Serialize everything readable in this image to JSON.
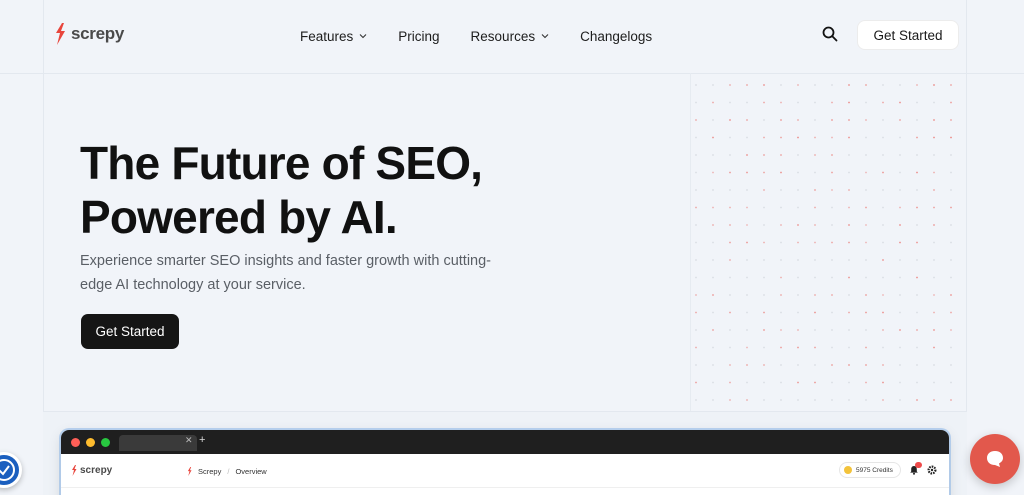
{
  "brand": {
    "name": "screpy",
    "accent": "#e8453c"
  },
  "nav": {
    "links": [
      {
        "label": "Features",
        "has_dropdown": true
      },
      {
        "label": "Pricing",
        "has_dropdown": false
      },
      {
        "label": "Resources",
        "has_dropdown": true
      },
      {
        "label": "Changelogs",
        "has_dropdown": false
      }
    ],
    "cta_label": "Get Started"
  },
  "hero": {
    "title_line1": "The Future of SEO,",
    "title_line2": "Powered by AI.",
    "subtitle": "Experience smarter SEO insights and faster growth with cutting-edge AI technology at your service.",
    "cta_label": "Get Started"
  },
  "preview": {
    "app_logo": "screpy",
    "breadcrumb": [
      "Screpy",
      "Overview"
    ],
    "credits": "5975 Credits"
  },
  "colors": {
    "dark_button": "#151515",
    "chat_button": "#e2584c",
    "a11y_button": "#1b5fbf"
  }
}
